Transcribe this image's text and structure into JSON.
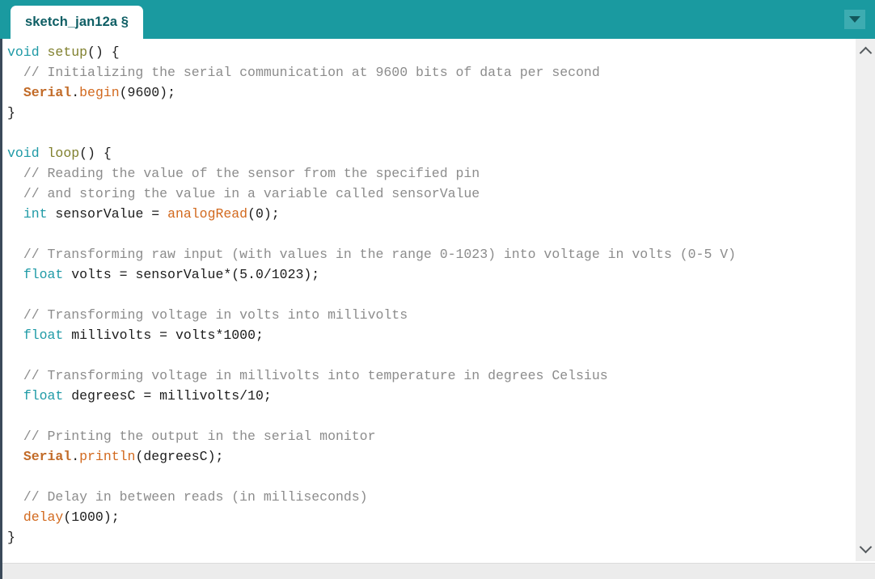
{
  "window": {
    "accent_teal": "#1a9aa0",
    "tab_button_teal": "#3dacb1",
    "pane_border": "#3b4a5a",
    "background": "#ffffff"
  },
  "tab_bar": {
    "active_tab_label": "sketch_jan12a §",
    "menu_button_icon": "caret-down-icon"
  },
  "scrollbar": {
    "up_icon": "chevron-up-icon",
    "down_icon": "chevron-down-icon",
    "track_color": "#efefef"
  },
  "editor": {
    "language": "arduino-c",
    "colors": {
      "keyword": "#1f9aa6",
      "function_name": "#80802e",
      "comment": "#8c8c8c",
      "library": "#c26b28",
      "method": "#d2691e",
      "plain": "#1c1c1c"
    },
    "lines": [
      [
        {
          "t": "void",
          "c": "kw"
        },
        {
          "t": " ",
          "c": "plain"
        },
        {
          "t": "setup",
          "c": "fn"
        },
        {
          "t": "() {",
          "c": "plain"
        }
      ],
      [
        {
          "t": "  ",
          "c": "plain"
        },
        {
          "t": "// Initializing the serial communication at 9600 bits of data per second",
          "c": "comment"
        }
      ],
      [
        {
          "t": "  ",
          "c": "plain"
        },
        {
          "t": "Serial",
          "c": "lib"
        },
        {
          "t": ".",
          "c": "plain"
        },
        {
          "t": "begin",
          "c": "method"
        },
        {
          "t": "(9600);",
          "c": "plain"
        }
      ],
      [
        {
          "t": "}",
          "c": "plain"
        }
      ],
      [
        {
          "t": "",
          "c": "plain"
        }
      ],
      [
        {
          "t": "void",
          "c": "kw"
        },
        {
          "t": " ",
          "c": "plain"
        },
        {
          "t": "loop",
          "c": "fn"
        },
        {
          "t": "() {",
          "c": "plain"
        }
      ],
      [
        {
          "t": "  ",
          "c": "plain"
        },
        {
          "t": "// Reading the value of the sensor from the specified pin",
          "c": "comment"
        }
      ],
      [
        {
          "t": "  ",
          "c": "plain"
        },
        {
          "t": "// and storing the value in a variable called sensorValue",
          "c": "comment"
        }
      ],
      [
        {
          "t": "  ",
          "c": "plain"
        },
        {
          "t": "int",
          "c": "kw"
        },
        {
          "t": " sensorValue = ",
          "c": "plain"
        },
        {
          "t": "analogRead",
          "c": "method"
        },
        {
          "t": "(0);",
          "c": "plain"
        }
      ],
      [
        {
          "t": "",
          "c": "plain"
        }
      ],
      [
        {
          "t": "  ",
          "c": "plain"
        },
        {
          "t": "// Transforming raw input (with values in the range 0-1023) into voltage in volts (0-5 V)",
          "c": "comment"
        }
      ],
      [
        {
          "t": "  ",
          "c": "plain"
        },
        {
          "t": "float",
          "c": "kw"
        },
        {
          "t": " volts = sensorValue*(5.0/1023);",
          "c": "plain"
        }
      ],
      [
        {
          "t": "",
          "c": "plain"
        }
      ],
      [
        {
          "t": "  ",
          "c": "plain"
        },
        {
          "t": "// Transforming voltage in volts into millivolts",
          "c": "comment"
        }
      ],
      [
        {
          "t": "  ",
          "c": "plain"
        },
        {
          "t": "float",
          "c": "kw"
        },
        {
          "t": " millivolts = volts*1000;",
          "c": "plain"
        }
      ],
      [
        {
          "t": "",
          "c": "plain"
        }
      ],
      [
        {
          "t": "  ",
          "c": "plain"
        },
        {
          "t": "// Transforming voltage in millivolts into temperature in degrees Celsius",
          "c": "comment"
        }
      ],
      [
        {
          "t": "  ",
          "c": "plain"
        },
        {
          "t": "float",
          "c": "kw"
        },
        {
          "t": " degreesC = millivolts/10;",
          "c": "plain"
        }
      ],
      [
        {
          "t": "",
          "c": "plain"
        }
      ],
      [
        {
          "t": "  ",
          "c": "plain"
        },
        {
          "t": "// Printing the output in the serial monitor",
          "c": "comment"
        }
      ],
      [
        {
          "t": "  ",
          "c": "plain"
        },
        {
          "t": "Serial",
          "c": "lib"
        },
        {
          "t": ".",
          "c": "plain"
        },
        {
          "t": "println",
          "c": "method"
        },
        {
          "t": "(degreesC);",
          "c": "plain"
        }
      ],
      [
        {
          "t": "",
          "c": "plain"
        }
      ],
      [
        {
          "t": "  ",
          "c": "plain"
        },
        {
          "t": "// Delay in between reads (in milliseconds)",
          "c": "comment"
        }
      ],
      [
        {
          "t": "  ",
          "c": "plain"
        },
        {
          "t": "delay",
          "c": "method"
        },
        {
          "t": "(1000);",
          "c": "plain"
        }
      ],
      [
        {
          "t": "}",
          "c": "plain"
        }
      ]
    ]
  }
}
